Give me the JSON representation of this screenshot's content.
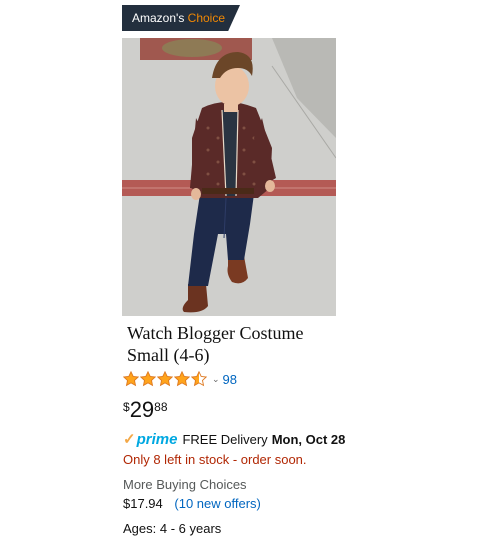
{
  "badge": {
    "prefix": "Amazon's",
    "accent": "Choice",
    "bg_color": "#232f3e",
    "accent_color": "#f08804"
  },
  "product": {
    "image_icon": "product-photo",
    "title_line1": "Watch Blogger Costume",
    "title_line2": "Small (4-6)",
    "rating": {
      "stars": 4.5,
      "star_color": "#ffa41c",
      "count": "98"
    },
    "price": {
      "currency": "$",
      "whole": "29",
      "fraction": "88"
    },
    "delivery": {
      "prime_check": "✓",
      "prime_word": "prime",
      "free_text": "FREE Delivery",
      "date": "Mon, Oct 28"
    },
    "stock": "Only 8 left in stock - order soon.",
    "more_buying": {
      "label": "More Buying Choices",
      "price": "$17.94",
      "offers_link": "(10 new offers)"
    },
    "ages": "Ages: 4 - 6 years"
  }
}
